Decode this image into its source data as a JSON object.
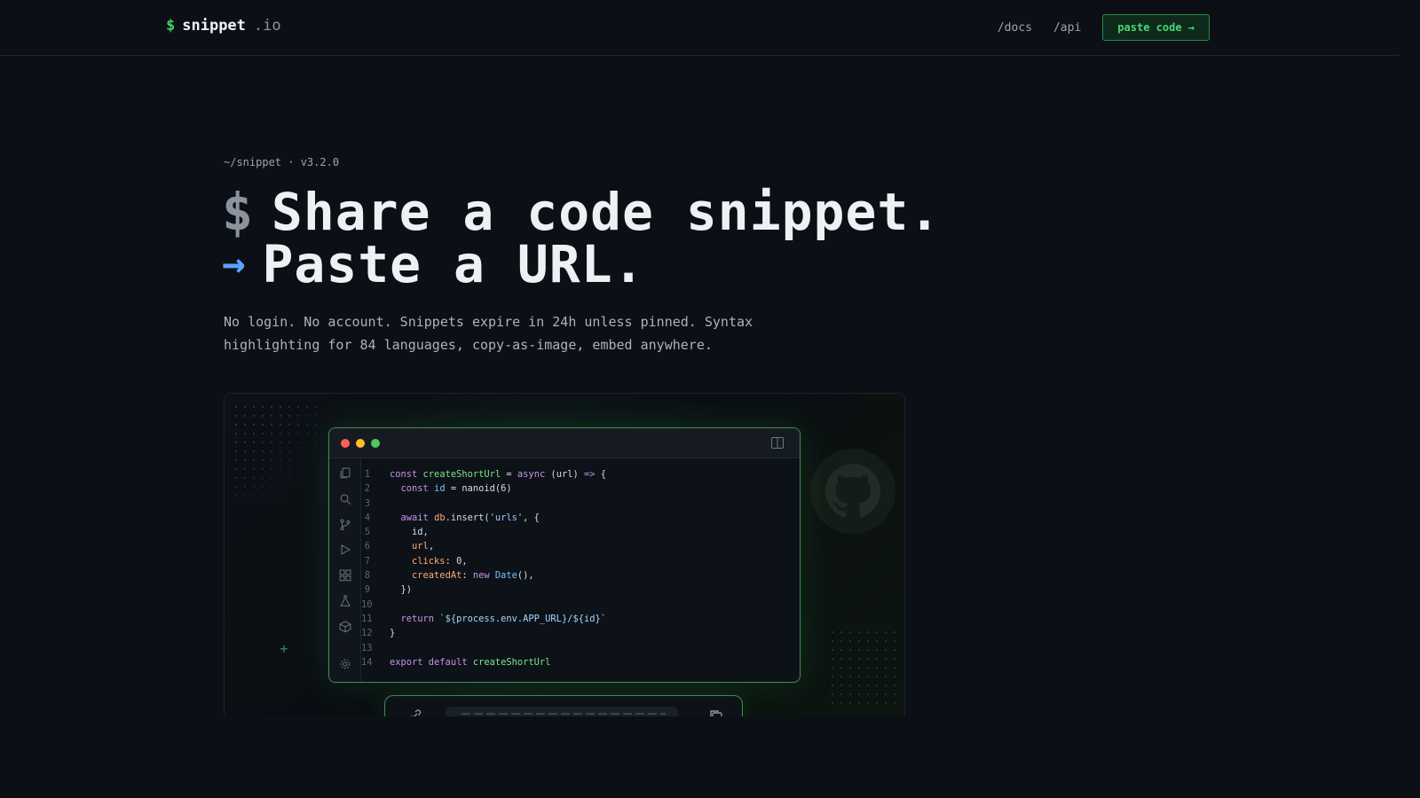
{
  "header": {
    "brand_symbol": "$",
    "brand_name": "snippet",
    "brand_tld": ".io",
    "nav_docs": "/docs",
    "nav_api": "/api",
    "cta_label": "paste code →"
  },
  "hero": {
    "kicker": "~/snippet · v3.2.0",
    "line1_prompt": "$",
    "line1_text": "Share a code snippet.",
    "line2_arrow": "→",
    "line2_text": "Paste a URL.",
    "description": "No login. No account. Snippets expire in 24h unless pinned. Syntax highlighting for 84 languages, copy-as-image, embed anywhere."
  },
  "preview": {
    "plus_symbol": "+",
    "code_lines": [
      {
        "n": "1",
        "tokens": [
          [
            "kw",
            "const "
          ],
          [
            "fn",
            "createShortUrl"
          ],
          [
            "",
            " = "
          ],
          [
            "kw",
            "async "
          ],
          [
            "",
            "(url) "
          ],
          [
            "kw",
            "=> "
          ],
          [
            "",
            "{"
          ]
        ]
      },
      {
        "n": "2",
        "tokens": [
          [
            "",
            "  "
          ],
          [
            "kw",
            "const "
          ],
          [
            "typ",
            "id"
          ],
          [
            "",
            " = nanoid(6)"
          ]
        ]
      },
      {
        "n": "3",
        "tokens": []
      },
      {
        "n": "4",
        "tokens": [
          [
            "",
            "  "
          ],
          [
            "kw",
            "await "
          ],
          [
            "prop",
            "db"
          ],
          [
            "",
            ".insert("
          ],
          [
            "str",
            "'urls'"
          ],
          [
            "",
            ", {"
          ]
        ]
      },
      {
        "n": "5",
        "tokens": [
          [
            "",
            "    id,"
          ]
        ]
      },
      {
        "n": "6",
        "tokens": [
          [
            "",
            "    "
          ],
          [
            "prop",
            "url"
          ],
          [
            "",
            ","
          ]
        ]
      },
      {
        "n": "7",
        "tokens": [
          [
            "",
            "    "
          ],
          [
            "prop",
            "clicks"
          ],
          [
            "",
            ": 0,"
          ]
        ]
      },
      {
        "n": "8",
        "tokens": [
          [
            "",
            "    "
          ],
          [
            "prop",
            "createdAt"
          ],
          [
            "",
            ": "
          ],
          [
            "kw",
            "new "
          ],
          [
            "typ",
            "Date"
          ],
          [
            "",
            "(),"
          ]
        ]
      },
      {
        "n": "9",
        "tokens": [
          [
            "",
            "  })"
          ]
        ]
      },
      {
        "n": "10",
        "tokens": []
      },
      {
        "n": "11",
        "tokens": [
          [
            "",
            "  "
          ],
          [
            "kw",
            "return "
          ],
          [
            "tpl",
            "`${process.env.APP_URL}/${id}`"
          ]
        ]
      },
      {
        "n": "12",
        "tokens": [
          [
            "",
            "}"
          ]
        ]
      },
      {
        "n": "13",
        "tokens": []
      },
      {
        "n": "14",
        "tokens": [
          [
            "kw",
            "export default "
          ],
          [
            "fn",
            "createShortUrl"
          ]
        ]
      }
    ]
  },
  "colors": {
    "accent_green": "#3fd16a",
    "accent_blue": "#58a6ff",
    "background": "#0c1016"
  },
  "icons": [
    "files-icon",
    "search-icon",
    "git-branch-icon",
    "run-icon",
    "extensions-icon",
    "flask-icon",
    "package-icon",
    "gear-icon",
    "split-view-icon",
    "github-icon",
    "link-icon",
    "copy-icon"
  ]
}
